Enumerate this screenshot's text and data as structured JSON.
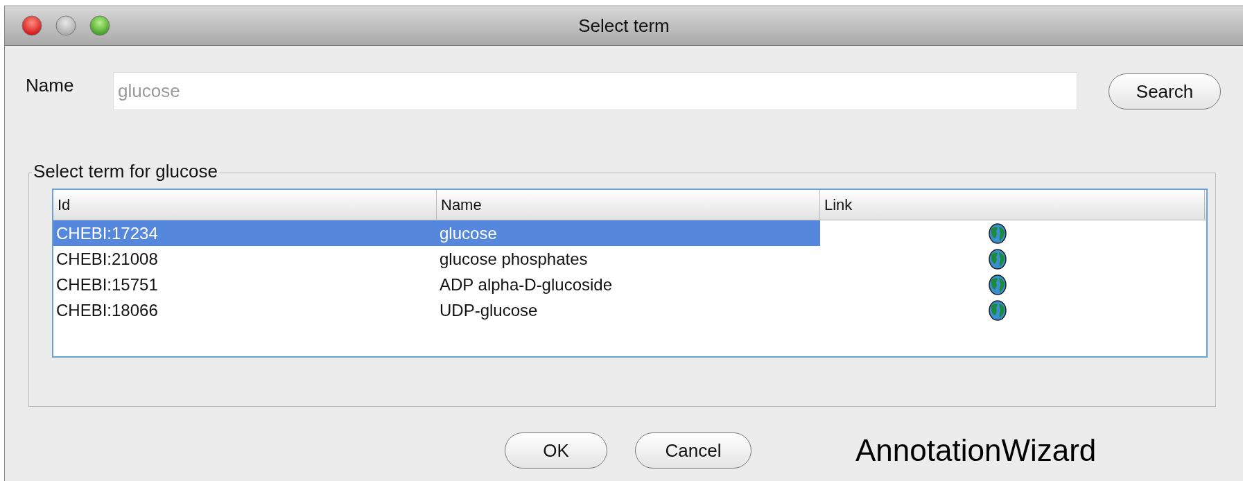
{
  "window": {
    "title": "Select term"
  },
  "name_field": {
    "label": "Name",
    "value": "glucose",
    "disabled": true
  },
  "search_button": "Search",
  "group": {
    "title": "Select term for glucose"
  },
  "table": {
    "columns": [
      "Id",
      "Name",
      "Link"
    ],
    "rows": [
      {
        "id": "CHEBI:17234",
        "name": "glucose",
        "selected": true
      },
      {
        "id": "CHEBI:21008",
        "name": "glucose phosphates",
        "selected": false
      },
      {
        "id": "CHEBI:15751",
        "name": "ADP alpha-D-glucoside",
        "selected": false
      },
      {
        "id": "CHEBI:18066",
        "name": "UDP-glucose",
        "selected": false
      }
    ]
  },
  "buttons": [
    "OK",
    "Cancel"
  ],
  "caption": "AnnotationWizard"
}
